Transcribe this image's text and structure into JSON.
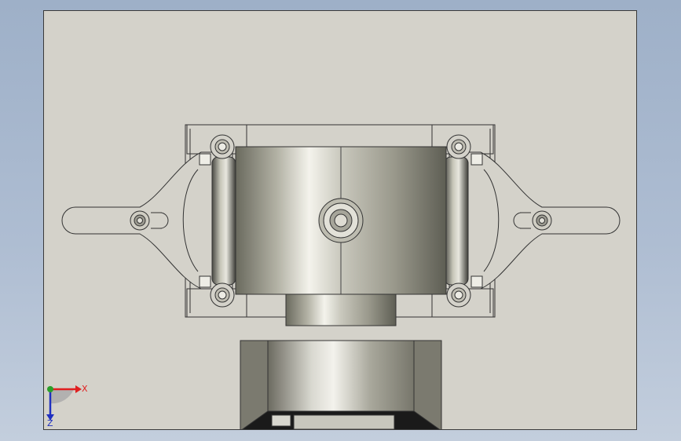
{
  "viewport": {
    "background": "#d4d2ca",
    "border": "#3a3a3a"
  },
  "triad": {
    "x_label": "X",
    "y_label": "Y",
    "z_label": "Z",
    "x_color": "#e02020",
    "y_color": "#2aa02a",
    "z_color": "#2030c0"
  },
  "icons": [
    "coordinate-triad-icon"
  ]
}
